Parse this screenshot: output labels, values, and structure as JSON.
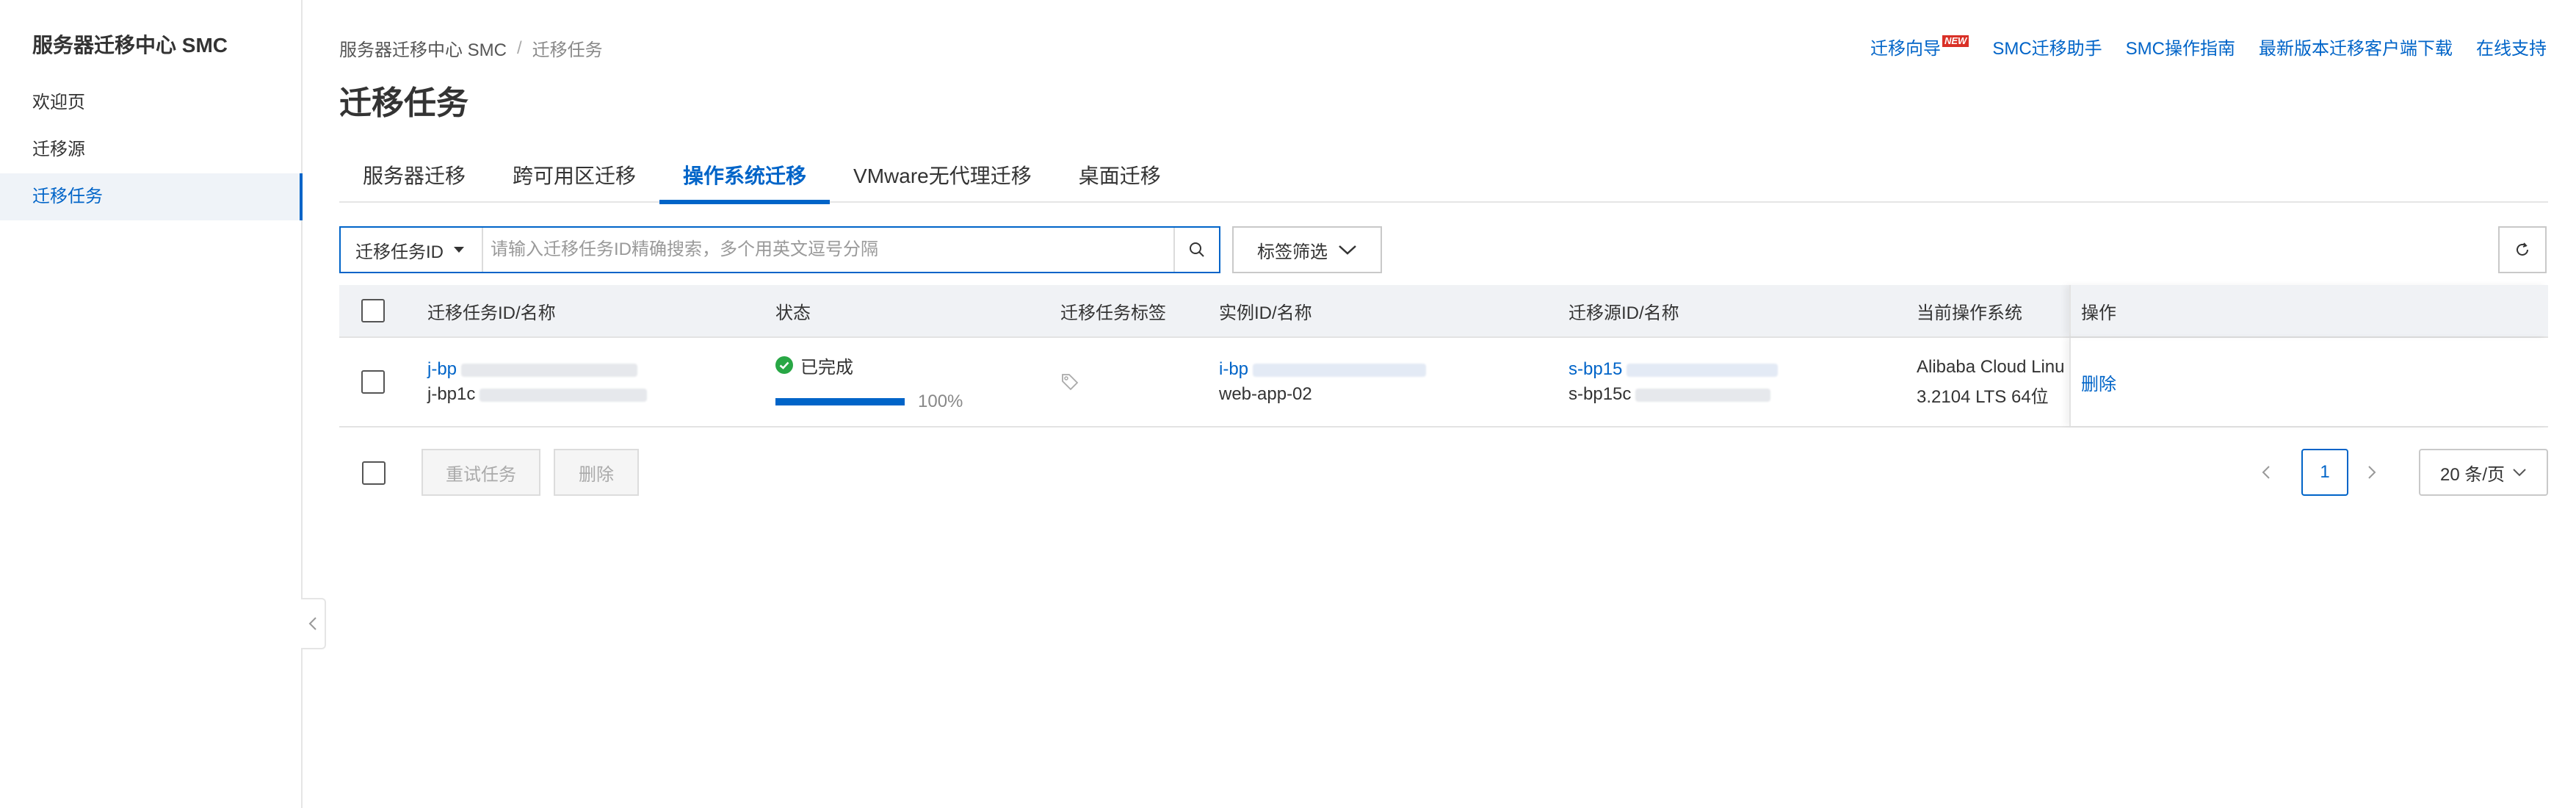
{
  "sidebar": {
    "title": "服务器迁移中心 SMC",
    "items": [
      {
        "label": "欢迎页",
        "active": false
      },
      {
        "label": "迁移源",
        "active": false
      },
      {
        "label": "迁移任务",
        "active": true
      }
    ],
    "collapse_icon": "chevron-left-icon"
  },
  "breadcrumb": {
    "root": "服务器迁移中心 SMC",
    "separator": "/",
    "current": "迁移任务"
  },
  "page_title": "迁移任务",
  "top_links": {
    "guide": "迁移向导",
    "guide_badge": "NEW",
    "assistant": "SMC迁移助手",
    "manual": "SMC操作指南",
    "download": "最新版本迁移客户端下载",
    "support": "在线支持"
  },
  "tabs": [
    {
      "label": "服务器迁移",
      "active": false
    },
    {
      "label": "跨可用区迁移",
      "active": false
    },
    {
      "label": "操作系统迁移",
      "active": true
    },
    {
      "label": "VMware无代理迁移",
      "active": false
    },
    {
      "label": "桌面迁移",
      "active": false
    }
  ],
  "search": {
    "type_label": "迁移任务ID",
    "placeholder": "请输入迁移任务ID精确搜索，多个用英文逗号分隔",
    "value": "",
    "tag_filter_label": "标签筛选"
  },
  "table": {
    "columns": [
      "迁移任务ID/名称",
      "状态",
      "迁移任务标签",
      "实例ID/名称",
      "迁移源ID/名称",
      "当前操作系统",
      "操作"
    ],
    "rows": [
      {
        "task_id": "j-bp",
        "task_name": "j-bp1c",
        "status": "已完成",
        "progress_percent": 100,
        "progress_text": "100%",
        "instance_id": "i-bp",
        "instance_name": "web-app-02",
        "source_id": "s-bp15",
        "source_name": "s-bp15c",
        "os_line1": "Alibaba Cloud Linu",
        "os_line2": "3.2104 LTS 64位",
        "action": "删除"
      }
    ]
  },
  "footer": {
    "retry_label": "重试任务",
    "delete_label": "删除",
    "current_page": "1",
    "page_size_label": "20 条/页"
  },
  "colors": {
    "accent": "#0064c8",
    "success": "#28a745",
    "new_badge": "#d93026"
  }
}
